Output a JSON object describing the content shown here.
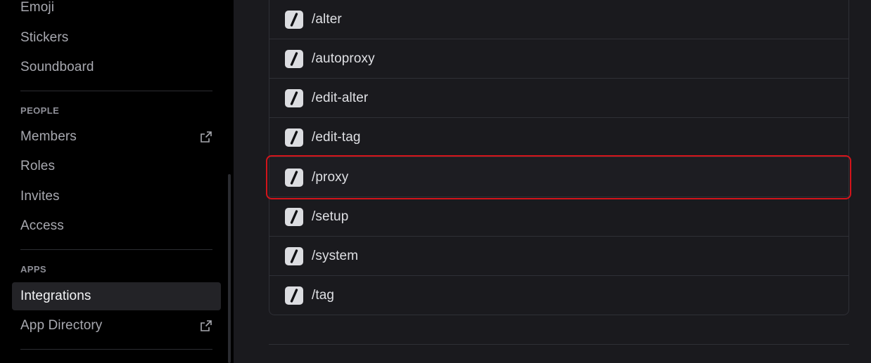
{
  "sidebar": {
    "top_items": [
      {
        "label": "Emoji"
      },
      {
        "label": "Stickers"
      },
      {
        "label": "Soundboard"
      }
    ],
    "people_header": "PEOPLE",
    "people_items": [
      {
        "label": "Members",
        "icon": "external-link-icon"
      },
      {
        "label": "Roles"
      },
      {
        "label": "Invites"
      },
      {
        "label": "Access"
      }
    ],
    "apps_header": "APPS",
    "apps_items": [
      {
        "label": "Integrations",
        "active": true
      },
      {
        "label": "App Directory",
        "icon": "external-link-icon"
      }
    ]
  },
  "commands": {
    "icon": "slash-command-icon",
    "items": [
      {
        "name": "/alter"
      },
      {
        "name": "/autoproxy"
      },
      {
        "name": "/edit-alter"
      },
      {
        "name": "/edit-tag"
      },
      {
        "name": "/proxy",
        "highlighted": true
      },
      {
        "name": "/setup"
      },
      {
        "name": "/system"
      },
      {
        "name": "/tag"
      }
    ]
  },
  "colors": {
    "sidebar_bg": "#000000",
    "main_bg": "#1a1a1e",
    "highlight_border": "#d3141b",
    "active_item_bg": "#232327"
  }
}
